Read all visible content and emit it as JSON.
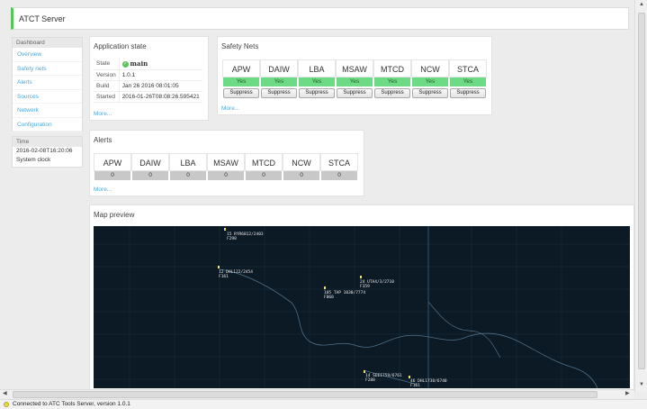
{
  "window": {
    "title": "ATCT Server"
  },
  "sidebar": {
    "heading": "Dashboard",
    "items": [
      {
        "label": "Overview"
      },
      {
        "label": "Safety nets"
      },
      {
        "label": "Alerts"
      },
      {
        "label": "Sources"
      },
      {
        "label": "Network"
      },
      {
        "label": "Configuration"
      }
    ]
  },
  "time": {
    "heading": "Time",
    "value": "2016-02-08T16:20:06",
    "source": "System clock"
  },
  "app_state": {
    "title": "Application state",
    "rows": [
      {
        "key": "State",
        "value": "main"
      },
      {
        "key": "Version",
        "value": "1.0.1"
      },
      {
        "key": "Build",
        "value": "Jan 26 2016 08:01:05"
      },
      {
        "key": "Started",
        "value": "2016-01-26T08:08:26.595421"
      }
    ],
    "more": "More..."
  },
  "safety_nets": {
    "title": "Safety Nets",
    "nets": [
      {
        "name": "APW",
        "status": "Yes",
        "action": "Suppress"
      },
      {
        "name": "DAIW",
        "status": "Yes",
        "action": "Suppress"
      },
      {
        "name": "LBA",
        "status": "Yes",
        "action": "Suppress"
      },
      {
        "name": "MSAW",
        "status": "Yes",
        "action": "Suppress"
      },
      {
        "name": "MTCD",
        "status": "Yes",
        "action": "Suppress"
      },
      {
        "name": "NCW",
        "status": "Yes",
        "action": "Suppress"
      },
      {
        "name": "STCA",
        "status": "Yes",
        "action": "Suppress"
      }
    ],
    "more": "More..."
  },
  "alerts": {
    "title": "Alerts",
    "items": [
      {
        "name": "APW",
        "count": "0"
      },
      {
        "name": "DAIW",
        "count": "0"
      },
      {
        "name": "LBA",
        "count": "0"
      },
      {
        "name": "MSAW",
        "count": "0"
      },
      {
        "name": "MTCD",
        "count": "0"
      },
      {
        "name": "NCW",
        "count": "0"
      },
      {
        "name": "STCA",
        "count": "0"
      }
    ],
    "more": "More..."
  },
  "map": {
    "title": "Map preview",
    "tracks": [
      {
        "line1": "15 RYR6812/2403",
        "line2": "F298"
      },
      {
        "line1": "12 DHL122/2454",
        "line2": "F161"
      },
      {
        "line1": "24 UTA4/3/2710",
        "line2": "F359"
      },
      {
        "line1": "105 TAP 1030/7774",
        "line2": "F068"
      },
      {
        "line1": "14 SEEI759/6761",
        "line2": "F288"
      },
      {
        "line1": "46 DHL1738/6740",
        "line2": "F161"
      }
    ]
  },
  "status": {
    "text": "Connected to ATC Tools Server, version 1.0.1"
  },
  "colors": {
    "accent": "#59c45b",
    "link": "#4aa8d8",
    "ok": "#6ddb86",
    "map_bg": "#0c1a26"
  }
}
